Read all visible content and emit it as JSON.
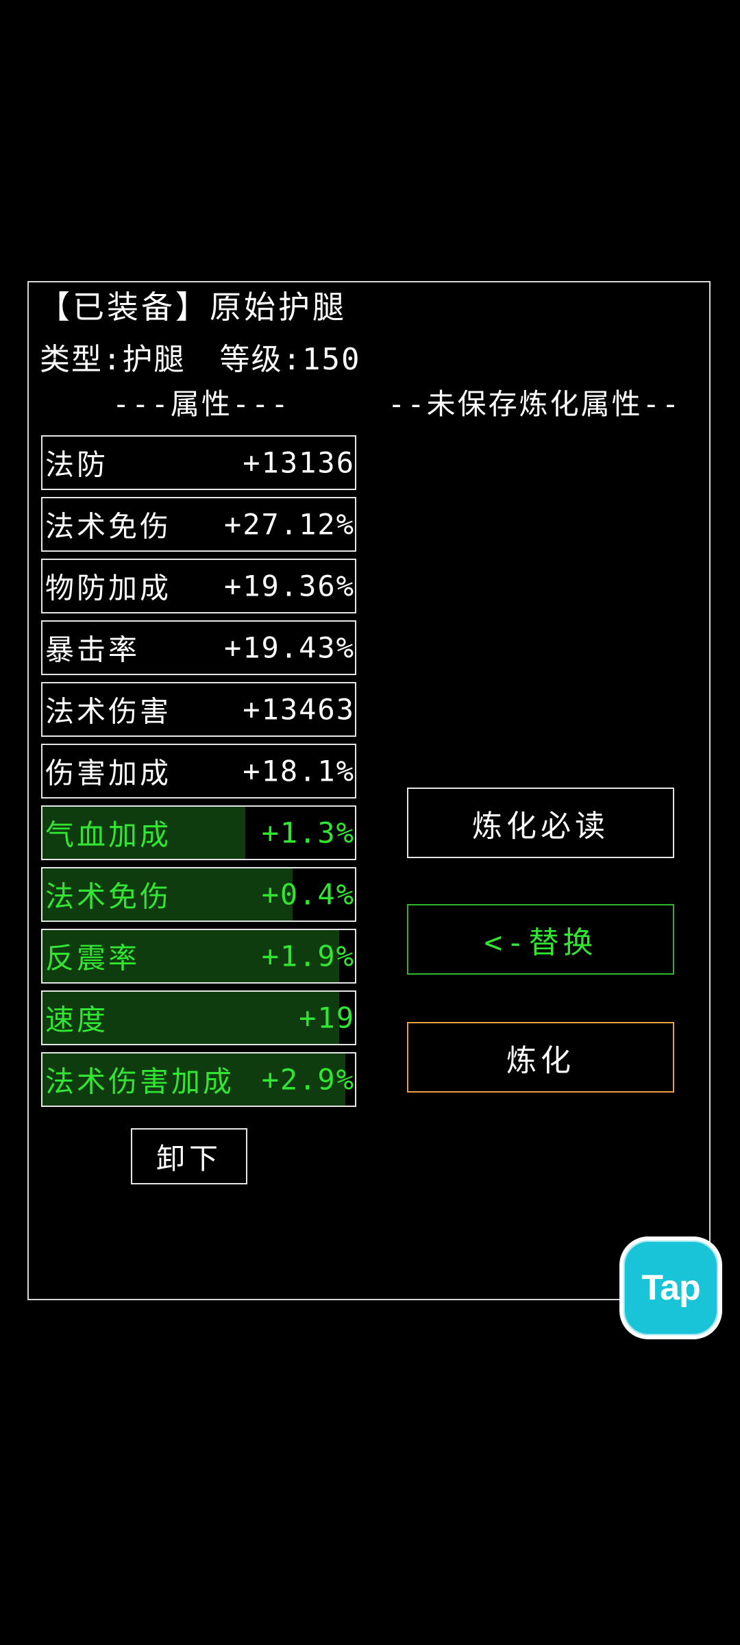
{
  "item": {
    "title": "【已装备】原始护腿",
    "type_label": "类型:护腿",
    "level_label": "等级:150"
  },
  "headers": {
    "attributes": "---属性---",
    "unsaved": "--未保存炼化属性--"
  },
  "base_stats": [
    {
      "name": "法防",
      "value": "+13136"
    },
    {
      "name": "法术免伤",
      "value": "+27.12%"
    },
    {
      "name": "物防加成",
      "value": "+19.36%"
    },
    {
      "name": "暴击率",
      "value": "+19.43%"
    },
    {
      "name": "法术伤害",
      "value": "+13463"
    },
    {
      "name": "伤害加成",
      "value": "+18.1%"
    }
  ],
  "refine_stats": [
    {
      "name": "气血加成",
      "value": "+1.3%",
      "fill_percent": 65
    },
    {
      "name": "法术免伤",
      "value": "+0.4%",
      "fill_percent": 80
    },
    {
      "name": "反震率",
      "value": "+1.9%",
      "fill_percent": 95
    },
    {
      "name": "速度",
      "value": "+19",
      "fill_percent": 95
    },
    {
      "name": "法术伤害加成",
      "value": "+2.9%",
      "fill_percent": 97
    }
  ],
  "buttons": {
    "guide": "炼化必读",
    "replace": "<-替换",
    "refine": "炼化",
    "unequip": "卸下"
  },
  "badge": {
    "label": "Tap"
  },
  "colors": {
    "refine_green": "#33e533",
    "refine_fill": "#0f3c0f",
    "replace_border": "#2fb52f",
    "refine_border": "#e8a040",
    "tap_badge": "#19c3d8"
  }
}
